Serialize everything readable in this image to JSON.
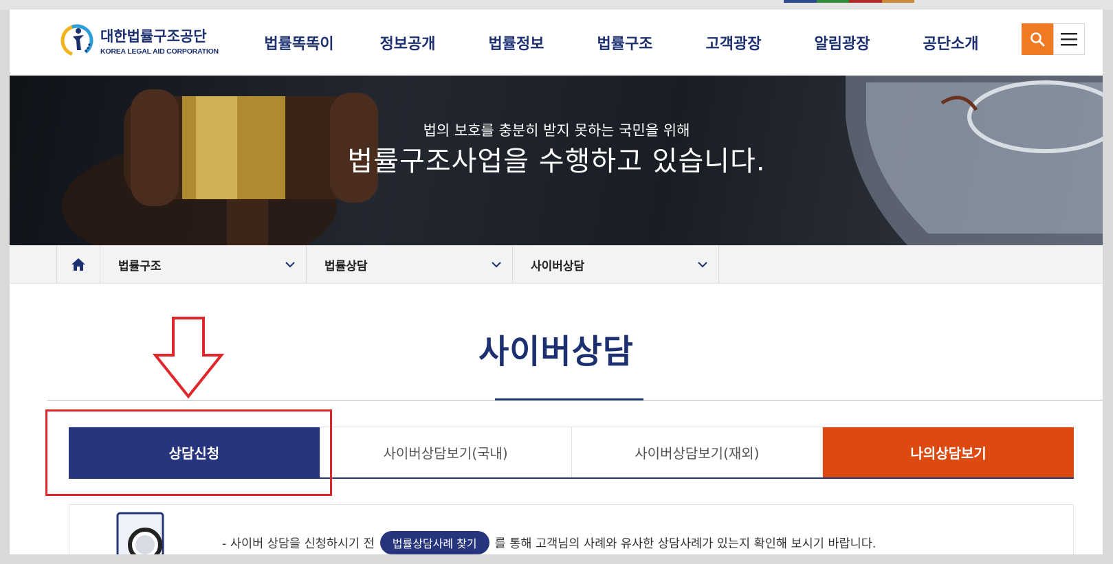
{
  "header": {
    "logo_ko": "대한법률구조공단",
    "logo_en": "KOREA LEGAL AID CORPORATION",
    "nav": [
      "법률똑똑이",
      "정보공개",
      "법률정보",
      "법률구조",
      "고객광장",
      "알림광장",
      "공단소개"
    ],
    "search_icon": "search-icon",
    "menu_icon": "hamburger-menu-icon"
  },
  "banner": {
    "sub": "법의 보호를 충분히 받지 못하는 국민을 위해",
    "main": "법률구조사업을 수행하고 있습니다."
  },
  "breadcrumb": {
    "home_icon": "home-icon",
    "items": [
      "법률구조",
      "법률상담",
      "사이버상담"
    ]
  },
  "page": {
    "title": "사이버상담"
  },
  "tabs": [
    "상담신청",
    "사이버상담보기(국내)",
    "사이버상담보기(재외)",
    "나의상담보기"
  ],
  "notice": {
    "prefix": "- 사이버 상담을 신청하시기 전",
    "button": "법률상담사례 찾기",
    "suffix": "를 통해 고객님의 사례와 유사한 상담사례가 있는지 확인해 보시기 바랍니다."
  },
  "colors": {
    "brand_navy": "#1c2f6f",
    "tab_active": "#26357e",
    "tab_orange": "#dc4a12",
    "search_orange": "#f07a23",
    "annotation_red": "#e0262b"
  }
}
